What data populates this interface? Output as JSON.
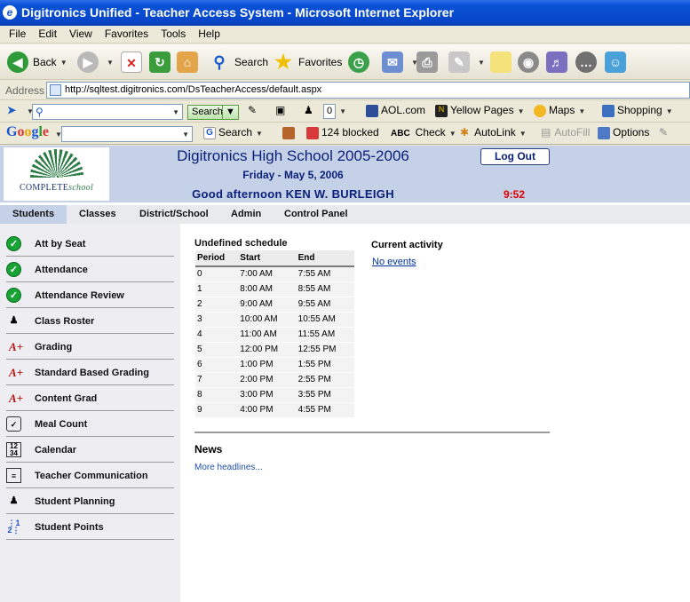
{
  "window": {
    "title": "Digitronics Unified - Teacher Access System - Microsoft Internet Explorer"
  },
  "menu": [
    "File",
    "Edit",
    "View",
    "Favorites",
    "Tools",
    "Help"
  ],
  "toolbar": {
    "back": "Back",
    "search": "Search",
    "favorites": "Favorites"
  },
  "address": {
    "label": "Address",
    "url": "http://sqltest.digitronics.com/DsTeacherAccess/default.aspx"
  },
  "links": {
    "search_btn": "Search",
    "popup_count": "0",
    "aol": "AOL.com",
    "yellow": "Yellow Pages",
    "maps": "Maps",
    "shopping": "Shopping"
  },
  "google": {
    "search": "Search",
    "blocked": "124 blocked",
    "check": "Check",
    "autolink": "AutoLink",
    "autofill": "AutoFill",
    "options": "Options"
  },
  "header": {
    "logo_text_a": "COMPLETE",
    "logo_text_b": "school",
    "school": "Digitronics High School 2005-2006",
    "date": "Friday - May 5, 2006",
    "greeting": "Good afternoon KEN W. BURLEIGH",
    "time": "9:52",
    "logout": "Log Out"
  },
  "tabs": [
    "Students",
    "Classes",
    "District/School",
    "Admin",
    "Control Panel"
  ],
  "sidebar": [
    {
      "label": "Att by Seat",
      "icon": "check-icon"
    },
    {
      "label": "Attendance",
      "icon": "check-icon"
    },
    {
      "label": "Attendance Review",
      "icon": "check-icon"
    },
    {
      "label": "Class Roster",
      "icon": "person-icon"
    },
    {
      "label": "Grading",
      "icon": "grade-icon"
    },
    {
      "label": "Standard Based Grading",
      "icon": "grade-icon"
    },
    {
      "label": "Content Grad",
      "icon": "grade-icon"
    },
    {
      "label": "Meal Count",
      "icon": "meal-icon"
    },
    {
      "label": "Calendar",
      "icon": "calendar-icon"
    },
    {
      "label": "Teacher Communication",
      "icon": "message-icon"
    },
    {
      "label": "Student Planning",
      "icon": "person-icon"
    },
    {
      "label": "Student Points",
      "icon": "points-icon"
    }
  ],
  "schedule": {
    "title": "Undefined schedule",
    "headers": [
      "Period",
      "Start",
      "End"
    ],
    "rows": [
      [
        "0",
        "7:00 AM",
        "7:55 AM"
      ],
      [
        "1",
        "8:00 AM",
        "8:55 AM"
      ],
      [
        "2",
        "9:00 AM",
        "9:55 AM"
      ],
      [
        "3",
        "10:00 AM",
        "10:55 AM"
      ],
      [
        "4",
        "11:00 AM",
        "11:55 AM"
      ],
      [
        "5",
        "12:00 PM",
        "12:55 PM"
      ],
      [
        "6",
        "1:00 PM",
        "1:55 PM"
      ],
      [
        "7",
        "2:00 PM",
        "2:55 PM"
      ],
      [
        "8",
        "3:00 PM",
        "3:55 PM"
      ],
      [
        "9",
        "4:00 PM",
        "4:55 PM"
      ]
    ]
  },
  "activity": {
    "title": "Current activity",
    "link": "No events"
  },
  "news": {
    "title": "News",
    "link": "More headlines..."
  }
}
